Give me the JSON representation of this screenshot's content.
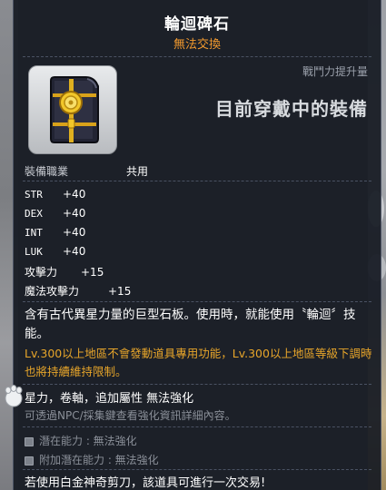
{
  "item": {
    "name": "輪迴碑石",
    "trade": "無法交換",
    "power_label": "戰鬥力提升量",
    "equipped_label": "目前穿戴中的裝備",
    "icon": "rebirth-stone-tablet-icon"
  },
  "job": {
    "label": "裝備職業",
    "value": "共用"
  },
  "stats": [
    {
      "name": "STR",
      "value": "+40"
    },
    {
      "name": "DEX",
      "value": "+40"
    },
    {
      "name": "INT",
      "value": "+40"
    },
    {
      "name": "LUK",
      "value": "+40"
    },
    {
      "name": "攻擊力",
      "value": "+15"
    },
    {
      "name": "魔法攻擊力",
      "value": "+15"
    }
  ],
  "description": "含有古代異星力量的巨型石板。使用時，就能使用〝輪迴〞技能。",
  "notice": "Lv.300以上地區不會發動道具專用功能，Lv.300以上地區等級下調時也將持續維持限制。",
  "enhance": {
    "title": "星力，卷軸，追加屬性 無法強化",
    "hint": "可透過NPC/採集鍵查看強化資訊詳細內容。"
  },
  "potential": [
    {
      "label": "潛在能力 : 無法強化"
    },
    {
      "label": "附加潛在能力 : 無法強化"
    }
  ],
  "footer": "若使用白金神奇剪刀，該道具可進行一次交易!",
  "colors": {
    "title": "#ffffff",
    "trade": "#f39a2e",
    "notice": "#e7a52a",
    "muted": "#8a8f98"
  }
}
